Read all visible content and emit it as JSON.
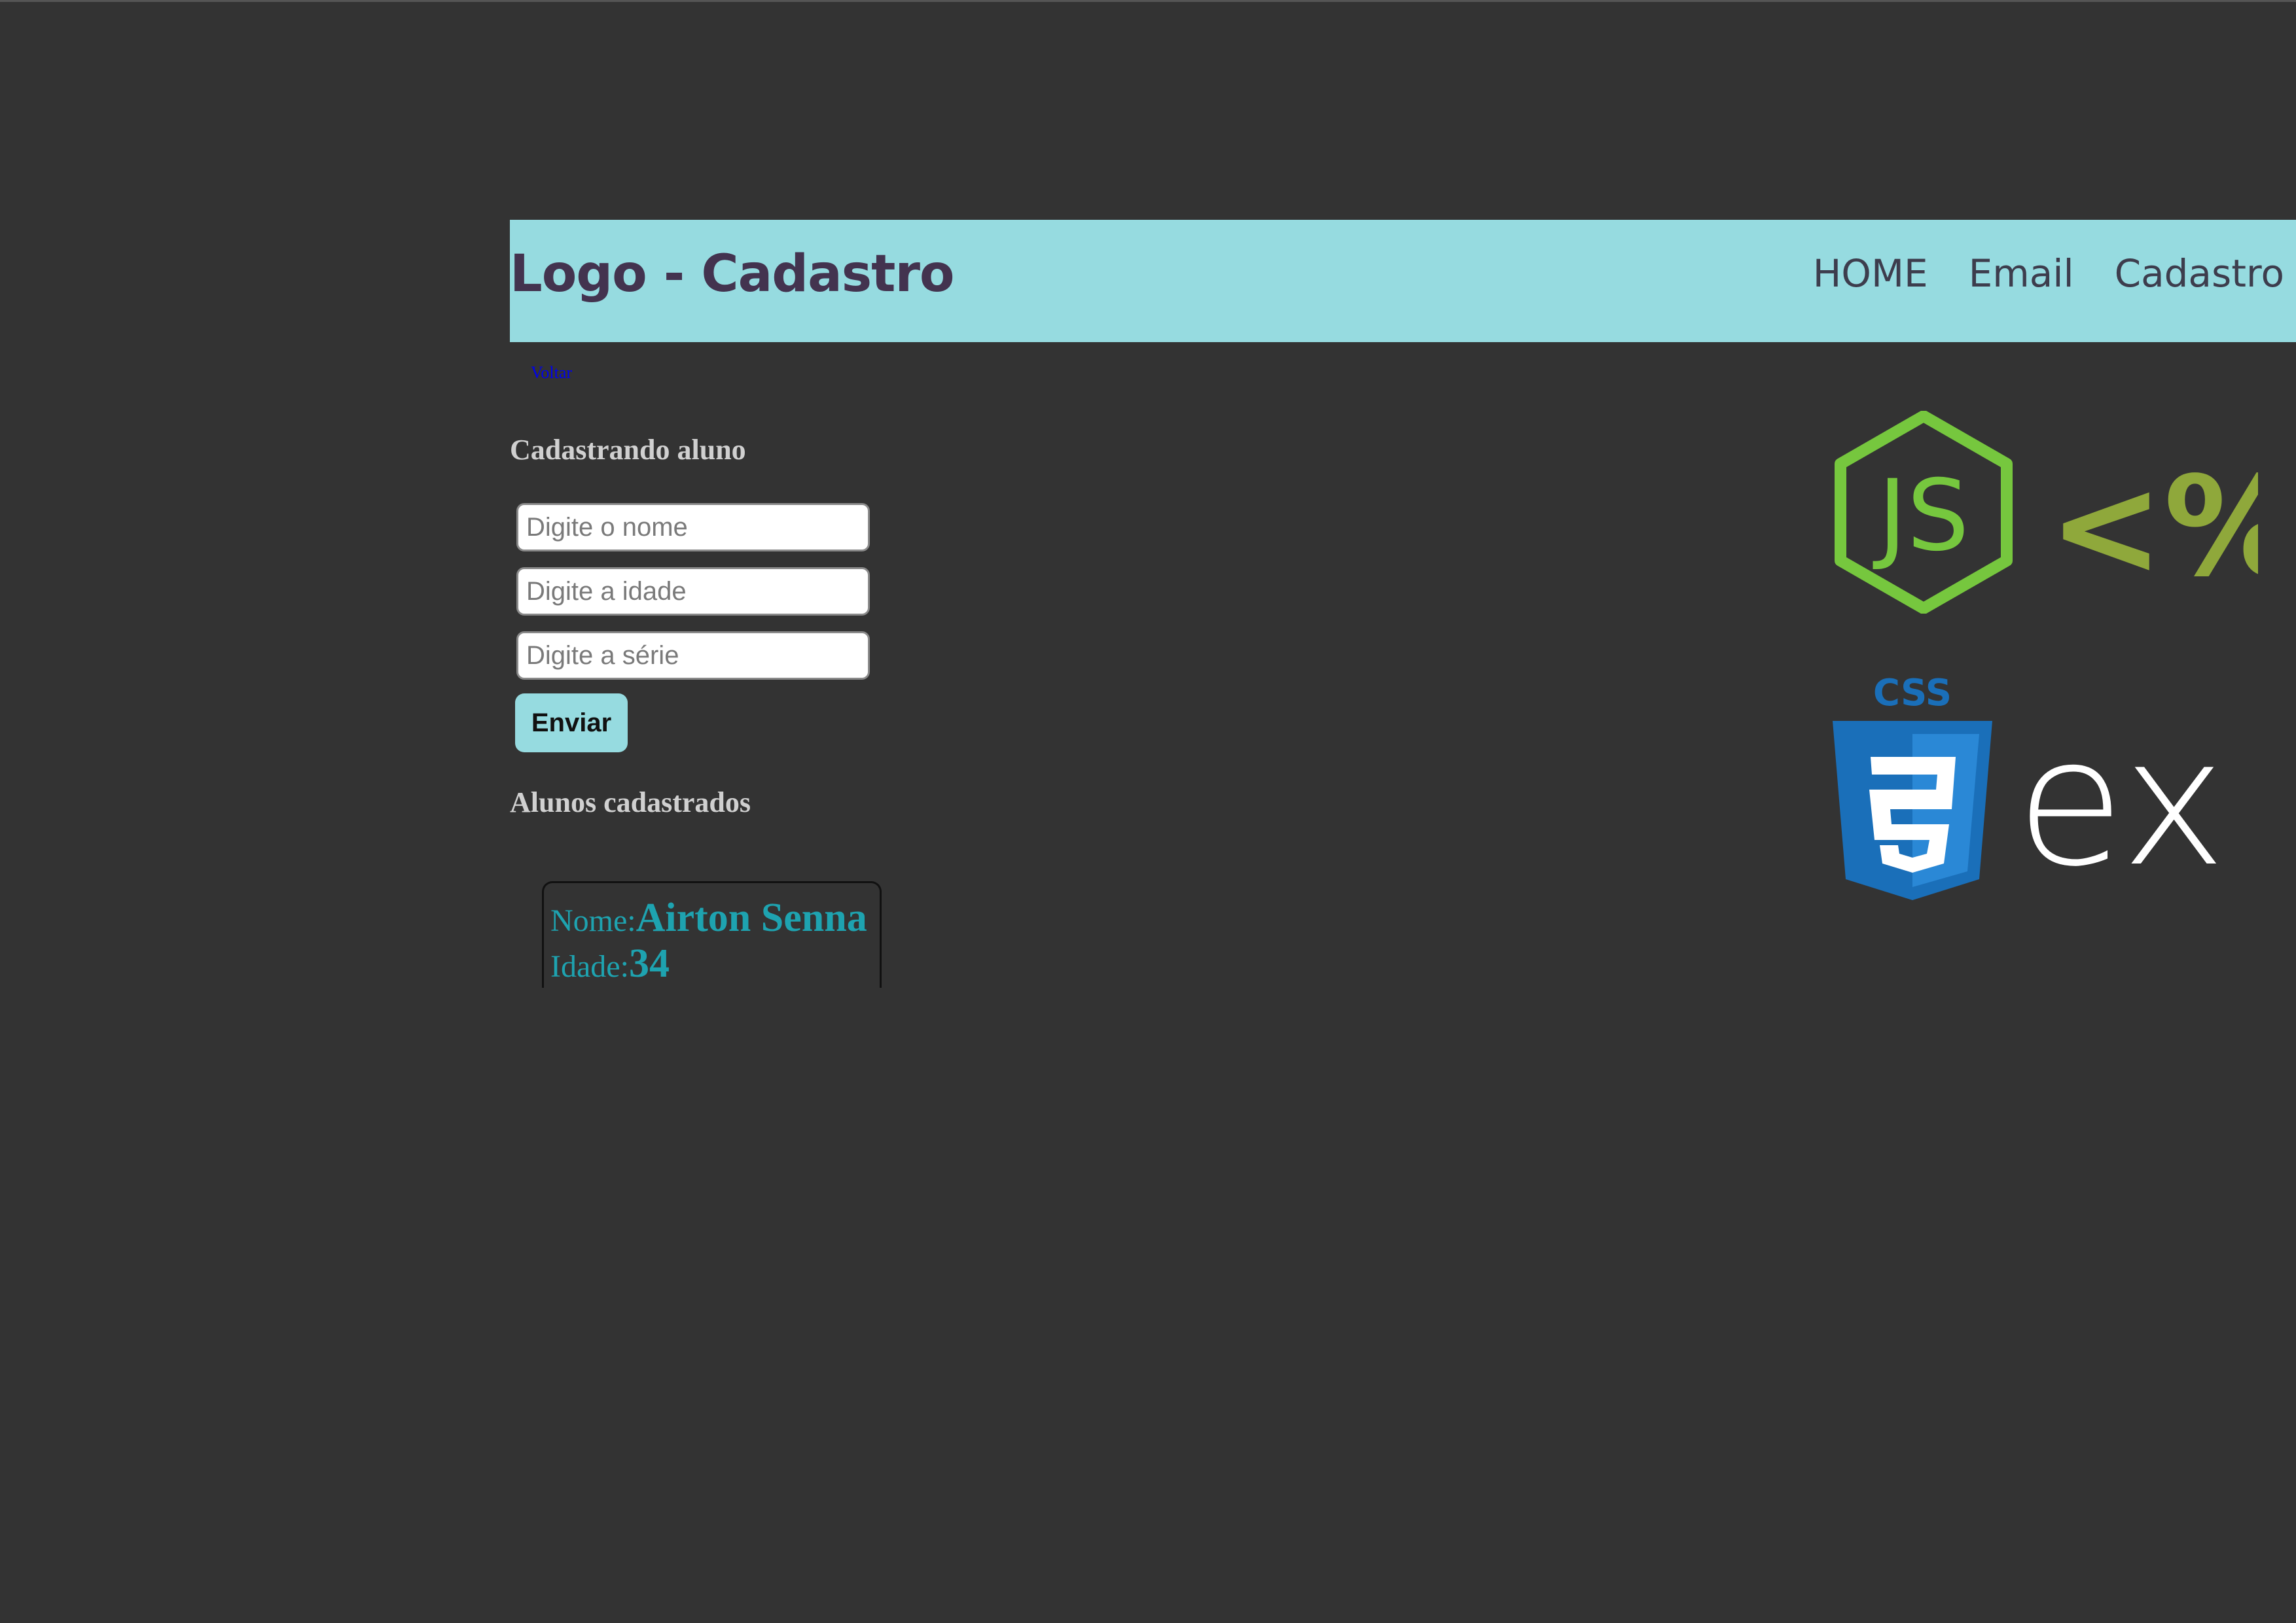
{
  "header": {
    "logo": "Logo - Cadastro",
    "nav": [
      {
        "label": "HOME"
      },
      {
        "label": "Email"
      },
      {
        "label": "Cadastro"
      }
    ]
  },
  "back_link": "Voltar",
  "form": {
    "heading": "Cadastrando aluno",
    "nome_placeholder": "Digite o nome",
    "idade_placeholder": "Digite a idade",
    "serie_placeholder": "Digite a série",
    "submit_label": "Enviar"
  },
  "list": {
    "heading": "Alunos cadastrados",
    "students": [
      {
        "nome_label": "Nome:",
        "nome": "Airton Senna",
        "idade_label": "Idade:",
        "idade": "34"
      }
    ]
  },
  "tech_logos": {
    "node": {
      "icon": "nodejs-icon",
      "text": "JS",
      "color": "#76c73e"
    },
    "ejs": {
      "icon": "ejs-icon",
      "text": "<%",
      "color": "#8fa83b"
    },
    "css3": {
      "icon": "css3-icon",
      "text": "CSS",
      "color": "#1a6fb9"
    },
    "express": {
      "icon": "express-icon",
      "text": "ex",
      "color": "#ffffff"
    }
  },
  "colors": {
    "background": "#333333",
    "header_bg": "#96dbe0",
    "logo_text": "#43334f",
    "accent_text": "#1ea3b0"
  }
}
